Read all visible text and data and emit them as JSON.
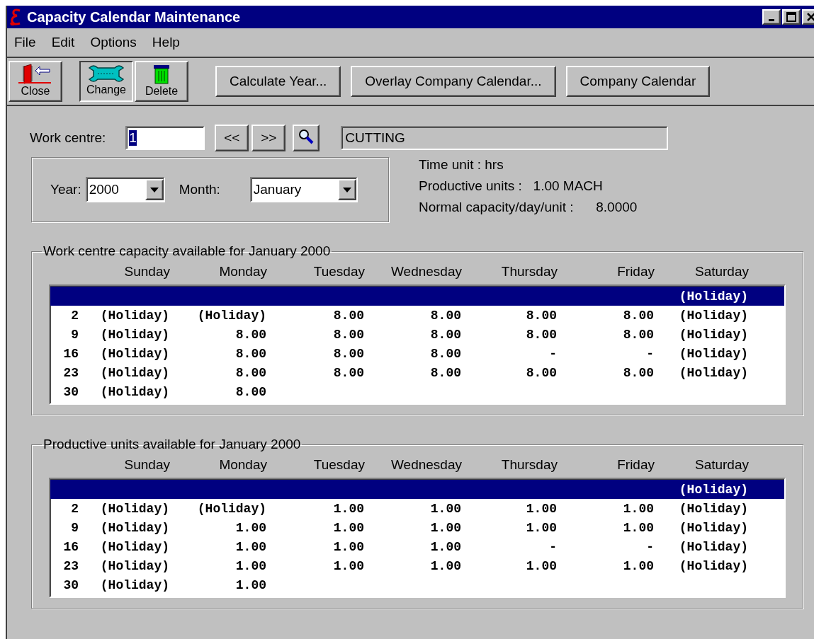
{
  "window": {
    "title": "Capacity Calendar Maintenance"
  },
  "menu": [
    "File",
    "Edit",
    "Options",
    "Help"
  ],
  "toolbar": {
    "icon_buttons": [
      {
        "kind": "close",
        "label": "Close",
        "pressed": false
      },
      {
        "kind": "change",
        "label": "Change",
        "pressed": true
      },
      {
        "kind": "delete",
        "label": "Delete",
        "pressed": false
      }
    ],
    "buttons": [
      "Calculate Year...",
      "Overlay Company Calendar...",
      "Company Calendar"
    ]
  },
  "work_centre": {
    "label": "Work centre:",
    "value": "1",
    "value_selected": true,
    "prev": "<<",
    "next": ">>",
    "description": "CUTTING"
  },
  "period": {
    "year_label": "Year:",
    "year": "2000",
    "month_label": "Month:",
    "month": "January"
  },
  "info": [
    "Time unit : hrs",
    "Productive units :   1.00 MACH",
    "Normal capacity/day/unit :      8.0000"
  ],
  "grids": [
    {
      "title": "Work centre capacity available for January 2000",
      "days": [
        "Sunday",
        "Monday",
        "Tuesday",
        "Wednesday",
        "Thursday",
        "Friday",
        "Saturday"
      ],
      "rows": [
        {
          "week": null,
          "selected": true,
          "cells": [
            null,
            null,
            null,
            null,
            null,
            null,
            "(Holiday)"
          ]
        },
        {
          "week": "2",
          "selected": false,
          "cells": [
            "(Holiday)",
            "(Holiday)",
            "8.00",
            "8.00",
            "8.00",
            "8.00",
            "(Holiday)"
          ]
        },
        {
          "week": "9",
          "selected": false,
          "cells": [
            "(Holiday)",
            "8.00",
            "8.00",
            "8.00",
            "8.00",
            "8.00",
            "(Holiday)"
          ]
        },
        {
          "week": "16",
          "selected": false,
          "cells": [
            "(Holiday)",
            "8.00",
            "8.00",
            "8.00",
            "-",
            "-",
            "(Holiday)"
          ]
        },
        {
          "week": "23",
          "selected": false,
          "cells": [
            "(Holiday)",
            "8.00",
            "8.00",
            "8.00",
            "8.00",
            "8.00",
            "(Holiday)"
          ]
        },
        {
          "week": "30",
          "selected": false,
          "cells": [
            "(Holiday)",
            "8.00",
            null,
            null,
            null,
            null,
            null
          ]
        }
      ]
    },
    {
      "title": "Productive units available for January 2000",
      "days": [
        "Sunday",
        "Monday",
        "Tuesday",
        "Wednesday",
        "Thursday",
        "Friday",
        "Saturday"
      ],
      "rows": [
        {
          "week": null,
          "selected": true,
          "cells": [
            null,
            null,
            null,
            null,
            null,
            null,
            "(Holiday)"
          ]
        },
        {
          "week": "2",
          "selected": false,
          "cells": [
            "(Holiday)",
            "(Holiday)",
            "1.00",
            "1.00",
            "1.00",
            "1.00",
            "(Holiday)"
          ]
        },
        {
          "week": "9",
          "selected": false,
          "cells": [
            "(Holiday)",
            "1.00",
            "1.00",
            "1.00",
            "1.00",
            "1.00",
            "(Holiday)"
          ]
        },
        {
          "week": "16",
          "selected": false,
          "cells": [
            "(Holiday)",
            "1.00",
            "1.00",
            "1.00",
            "-",
            "-",
            "(Holiday)"
          ]
        },
        {
          "week": "23",
          "selected": false,
          "cells": [
            "(Holiday)",
            "1.00",
            "1.00",
            "1.00",
            "1.00",
            "1.00",
            "(Holiday)"
          ]
        },
        {
          "week": "30",
          "selected": false,
          "cells": [
            "(Holiday)",
            "1.00",
            null,
            null,
            null,
            null,
            null
          ]
        }
      ]
    }
  ]
}
